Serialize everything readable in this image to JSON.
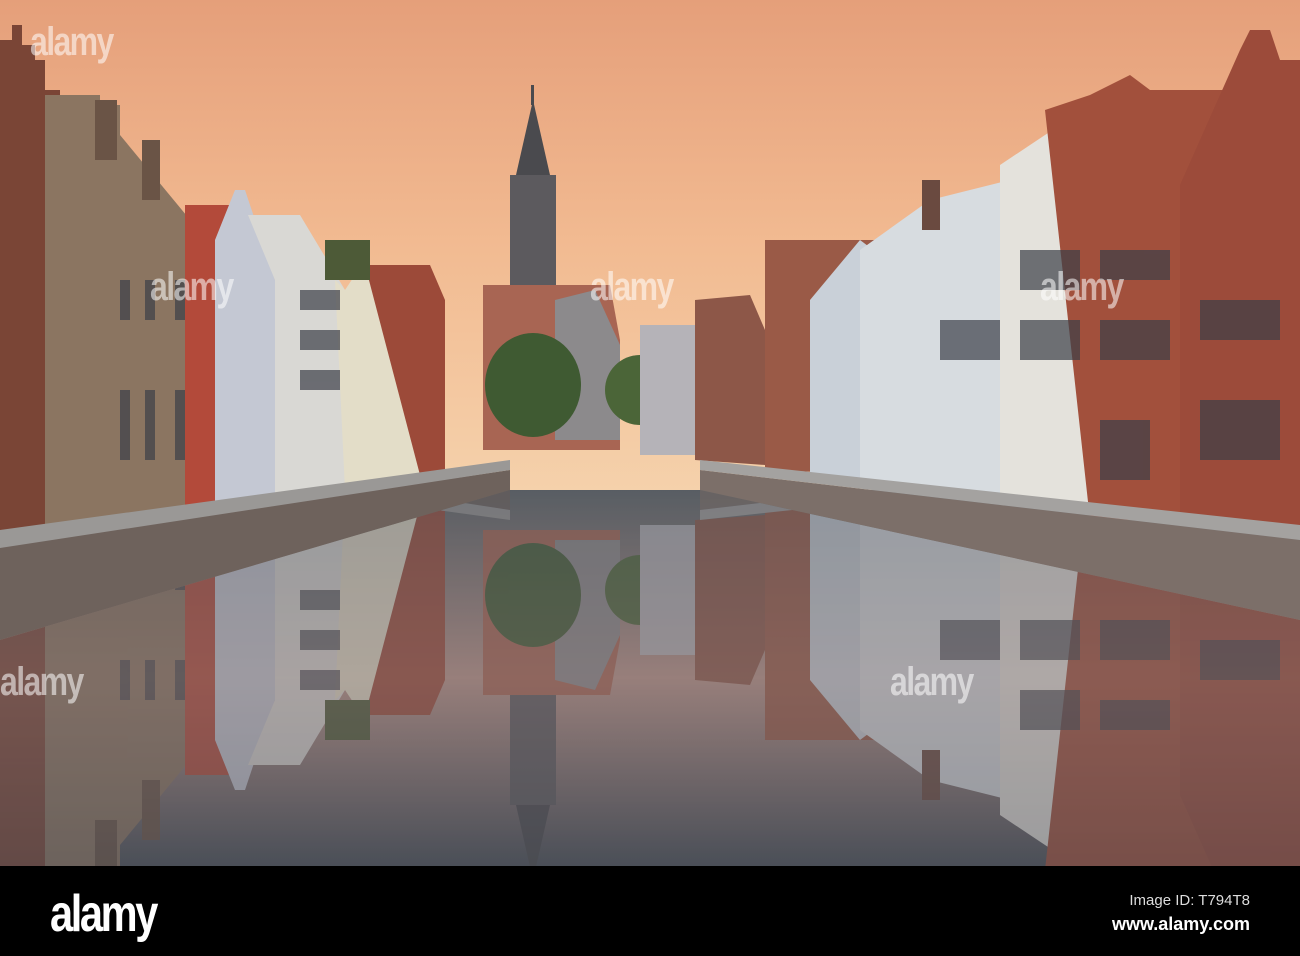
{
  "photo": {
    "subject": "Canal with gabled houses and bell tower at sunset, reflected in water"
  },
  "watermark": {
    "text": "alamy"
  },
  "footer": {
    "logo": "alamy",
    "image_id": "Image ID: T794T8",
    "website": "www.alamy.com"
  },
  "colors": {
    "sky_top": "#e8a77c",
    "sky_bottom": "#f3c9a0",
    "brick": "#8a4a38",
    "water": "#6b6e74"
  }
}
